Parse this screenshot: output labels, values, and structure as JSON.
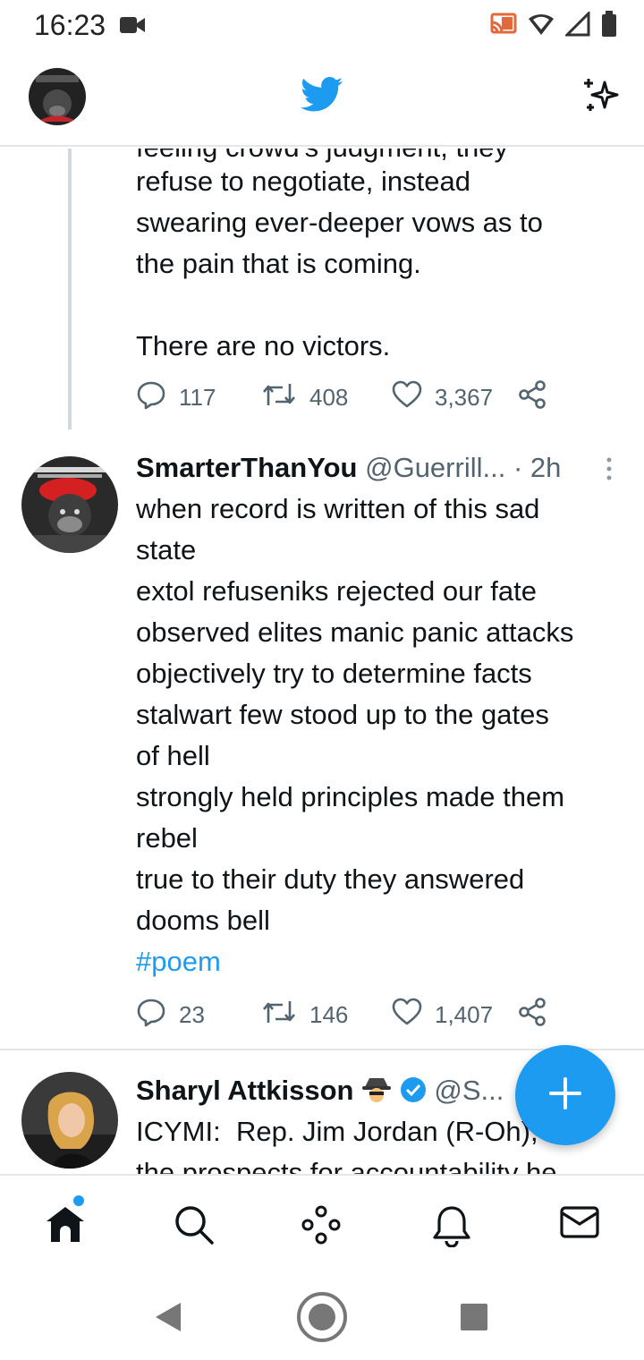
{
  "status_bar": {
    "time": "16:23"
  },
  "tweet_prev": {
    "clipped_line": "feeling crowd's judgment, they",
    "text": "refuse to negotiate, instead\nswearing ever-deeper vows as to\nthe pain that is coming.\n\nThere are no victors.",
    "replies": "117",
    "retweets": "408",
    "likes": "3,367"
  },
  "tweet_main": {
    "name": "SmarterThanYou",
    "handle": "@Guerrill...",
    "time": "· 2h",
    "text": "when record is written of this sad\nstate\nextol refuseniks rejected our fate\nobserved elites manic panic attacks\nobjectively try to determine facts\nstalwart few stood up to the gates\nof hell\nstrongly held principles made them\nrebel\ntrue to their duty they answered\ndooms bell",
    "hashtag": "#poem",
    "replies": "23",
    "retweets": "146",
    "likes": "1,407"
  },
  "tweet_next": {
    "name": "Sharyl Attkisson",
    "handle": "@S...",
    "text": "ICYMI:  Rep. Jim Jordan (R-Oh), on",
    "clipped_line": "the prospects for accountability he"
  },
  "colors": {
    "accent": "#1d9bf0",
    "text": "#0f1419",
    "muted": "#536471"
  },
  "icons": {
    "header": [
      "profile-avatar",
      "twitter-bird-icon",
      "sparkle-icon"
    ],
    "actions": [
      "reply-icon",
      "retweet-icon",
      "like-icon",
      "share-icon"
    ],
    "nav": [
      "home-icon",
      "search-icon",
      "spaces-icon",
      "notifications-icon",
      "messages-icon"
    ]
  }
}
